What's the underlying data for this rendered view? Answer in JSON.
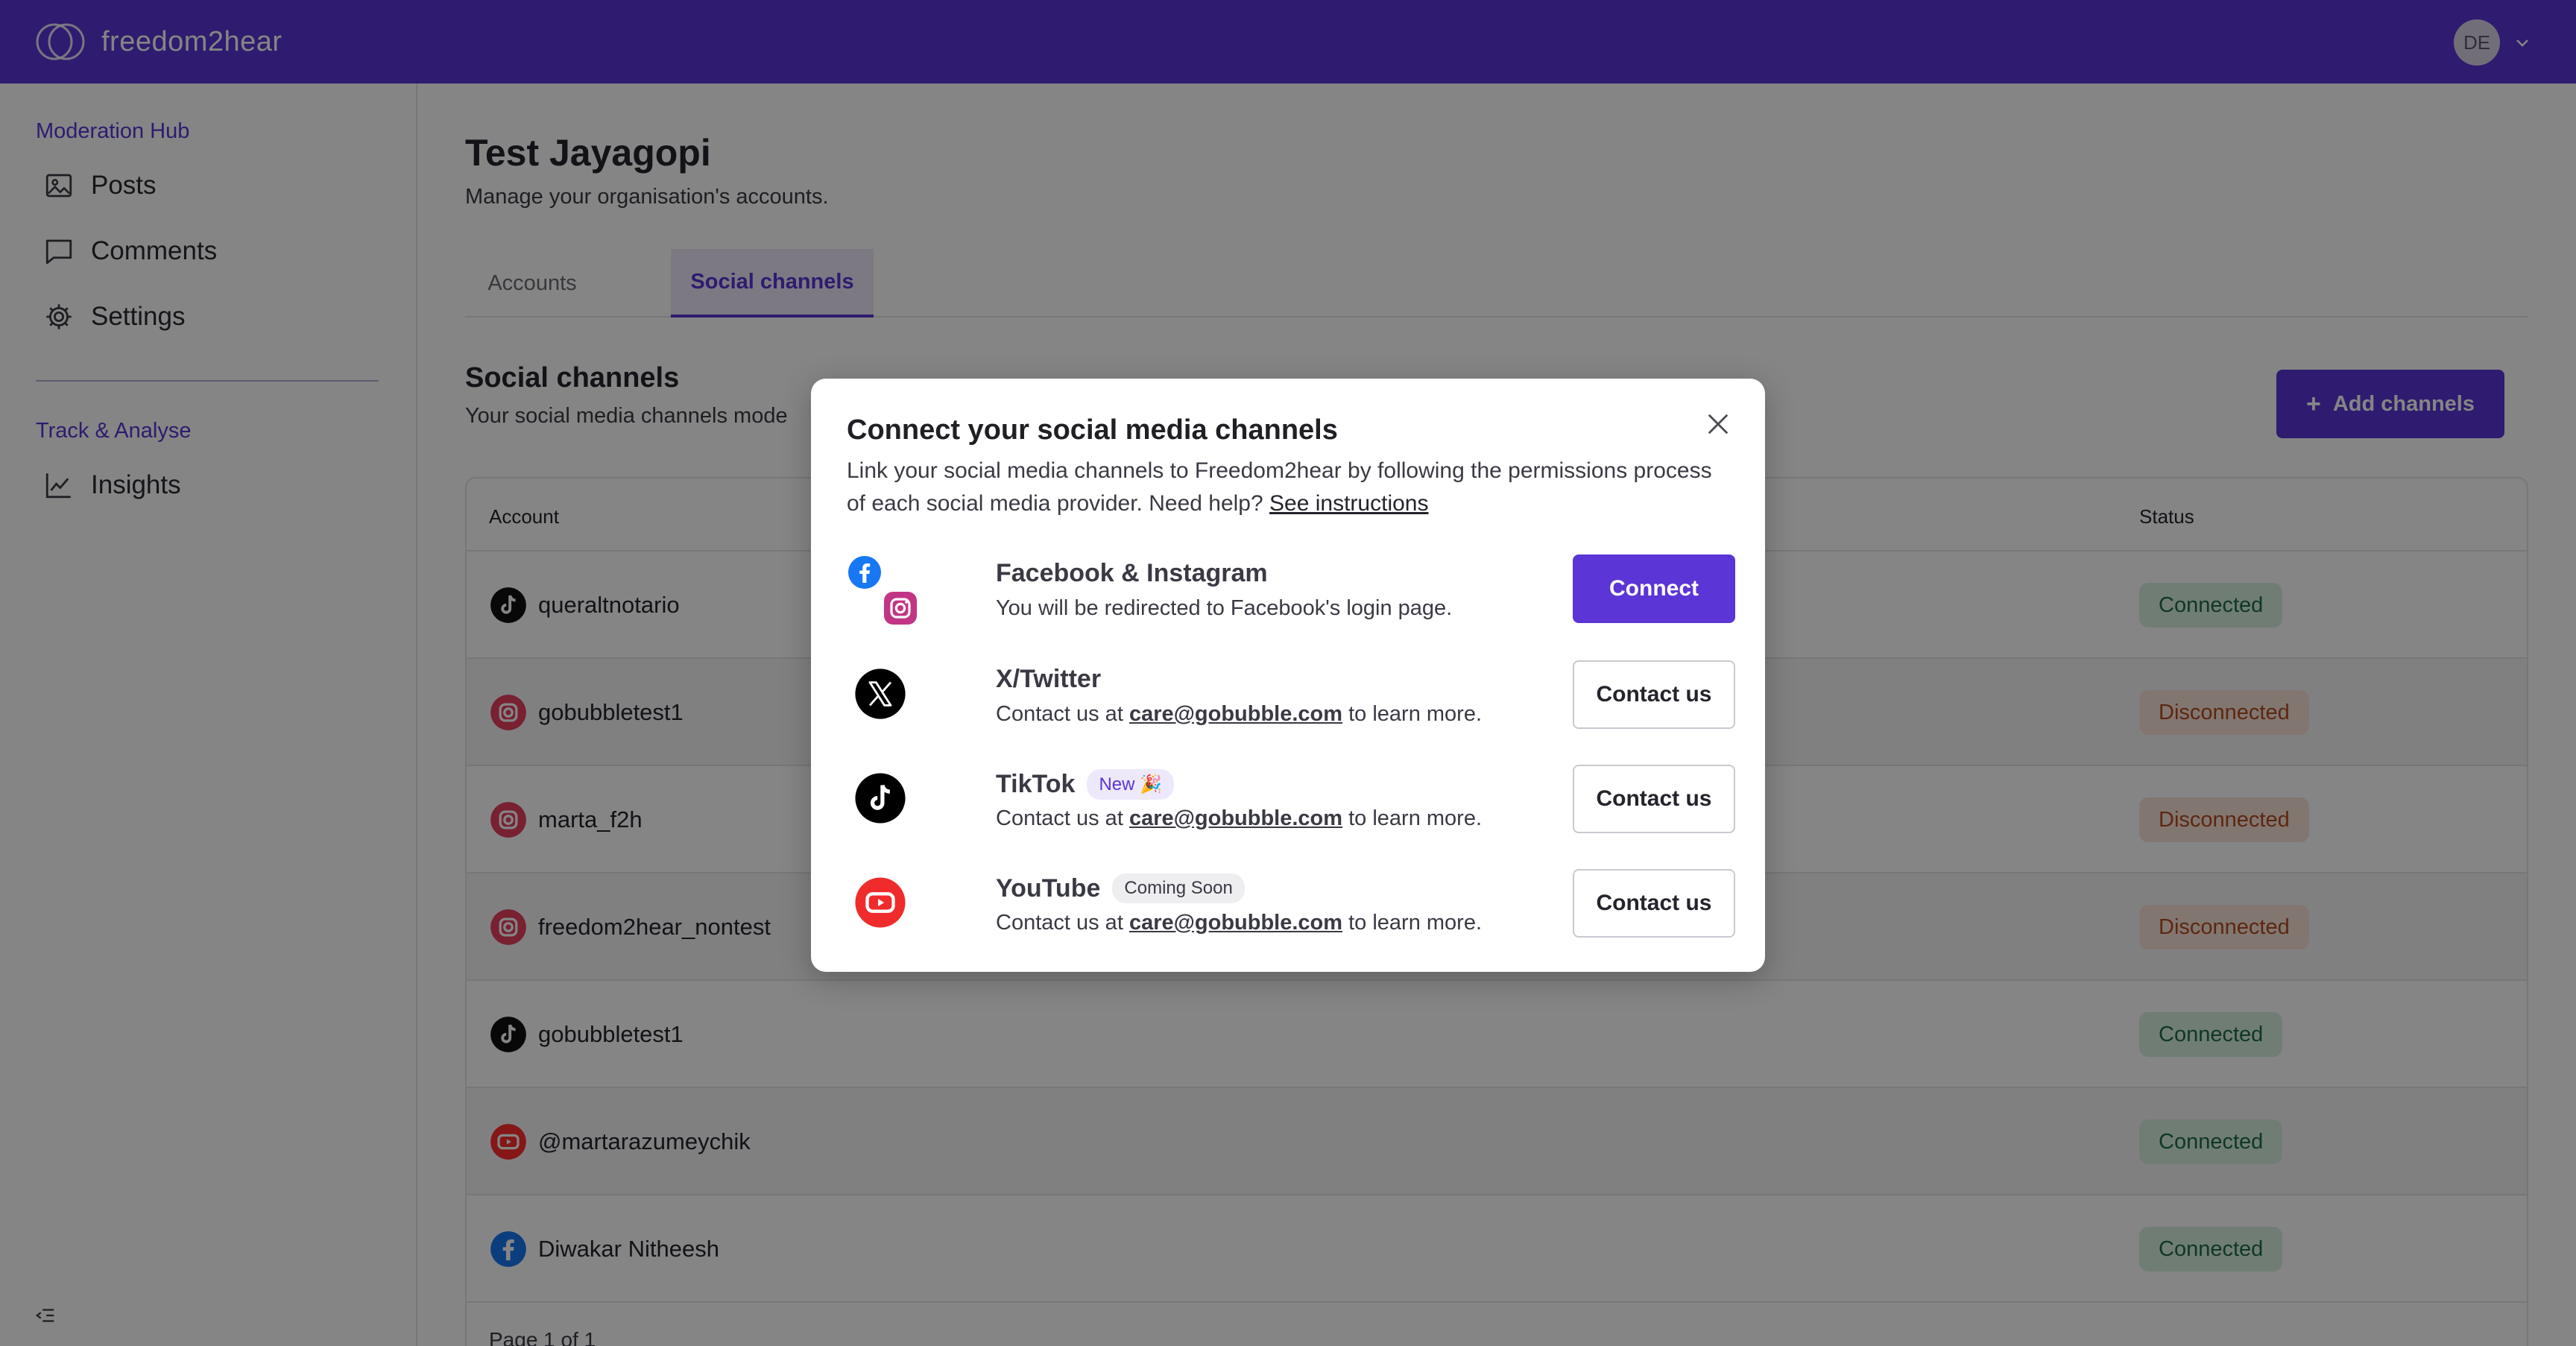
{
  "header": {
    "brand": "freedom2hear",
    "avatar_initials": "DE",
    "color": "#5b35d5"
  },
  "sidebar": {
    "section1": "Moderation Hub",
    "items": [
      {
        "label": "Posts",
        "icon": "image-icon"
      },
      {
        "label": "Comments",
        "icon": "comment-icon"
      },
      {
        "label": "Settings",
        "icon": "gear-icon"
      }
    ],
    "section2": "Track & Analyse",
    "items2": [
      {
        "label": "Insights",
        "icon": "chart-line-icon"
      }
    ]
  },
  "page": {
    "title": "Test Jayagopi",
    "subtitle": "Manage your organisation's accounts.",
    "tabs": [
      {
        "label": "Accounts"
      },
      {
        "label": "Social channels",
        "active": true
      }
    ],
    "section_title": "Social channels",
    "section_subtitle": "Your social media channels mode",
    "add_button": "Add channels"
  },
  "table": {
    "columns": [
      "Account",
      "Status"
    ],
    "rows": [
      {
        "account": "queraltnotario",
        "platform": "tiktok",
        "status": "Connected"
      },
      {
        "account": "gobubbletest1",
        "platform": "instagram",
        "status": "Disconnected"
      },
      {
        "account": "marta_f2h",
        "platform": "instagram",
        "status": "Disconnected"
      },
      {
        "account": "freedom2hear_nontest",
        "platform": "instagram",
        "status": "Disconnected"
      },
      {
        "account": "gobubbletest1",
        "platform": "tiktok",
        "status": "Connected"
      },
      {
        "account": "@martarazumeychik",
        "platform": "youtube",
        "status": "Connected"
      },
      {
        "account": "Diwakar Nitheesh",
        "platform": "facebook",
        "status": "Connected"
      }
    ],
    "pager": "Page 1 of 1"
  },
  "modal": {
    "title": "Connect your social media channels",
    "desc": "Link your social media channels to Freedom2hear by following the permissions process of each social media provider. Need help?",
    "desc_link": "See instructions",
    "providers": [
      {
        "name": "Facebook & Instagram",
        "text": "You will be redirected to Facebook's login page.",
        "button": "Connect"
      },
      {
        "name": "X/Twitter",
        "text_pre": "Contact us at",
        "email": "care@gobubble.com",
        "text_post": "to learn more.",
        "button": "Contact us"
      },
      {
        "name": "TikTok",
        "badge": "New 🎉",
        "text_pre": "Contact us at",
        "email": "care@gobubble.com",
        "text_post": "to learn more.",
        "button": "Contact us"
      },
      {
        "name": "YouTube",
        "badge": "Coming Soon",
        "text_pre": "Contact us at",
        "email": "care@gobubble.com",
        "text_post": "to learn more.",
        "button": "Contact us"
      }
    ]
  }
}
